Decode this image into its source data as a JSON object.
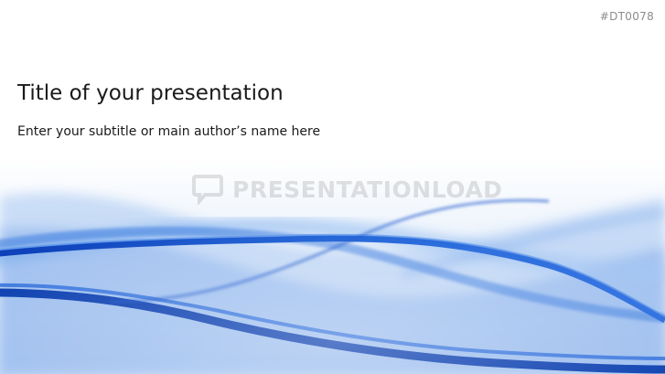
{
  "slide": {
    "code": "#DT0078",
    "title": "Title of your presentation",
    "subtitle": "Enter your subtitle or main author’s name here",
    "watermark": "PRESENTATIONLOAD"
  },
  "colors": {
    "accent_blue": "#1f5fd1",
    "deep_blue": "#0b3fb0",
    "light_blue": "#b9d3f5",
    "background": "#ffffff",
    "text": "#1a1a1a"
  },
  "icons": {
    "watermark_logo": "speech-bubble-logo-icon"
  }
}
